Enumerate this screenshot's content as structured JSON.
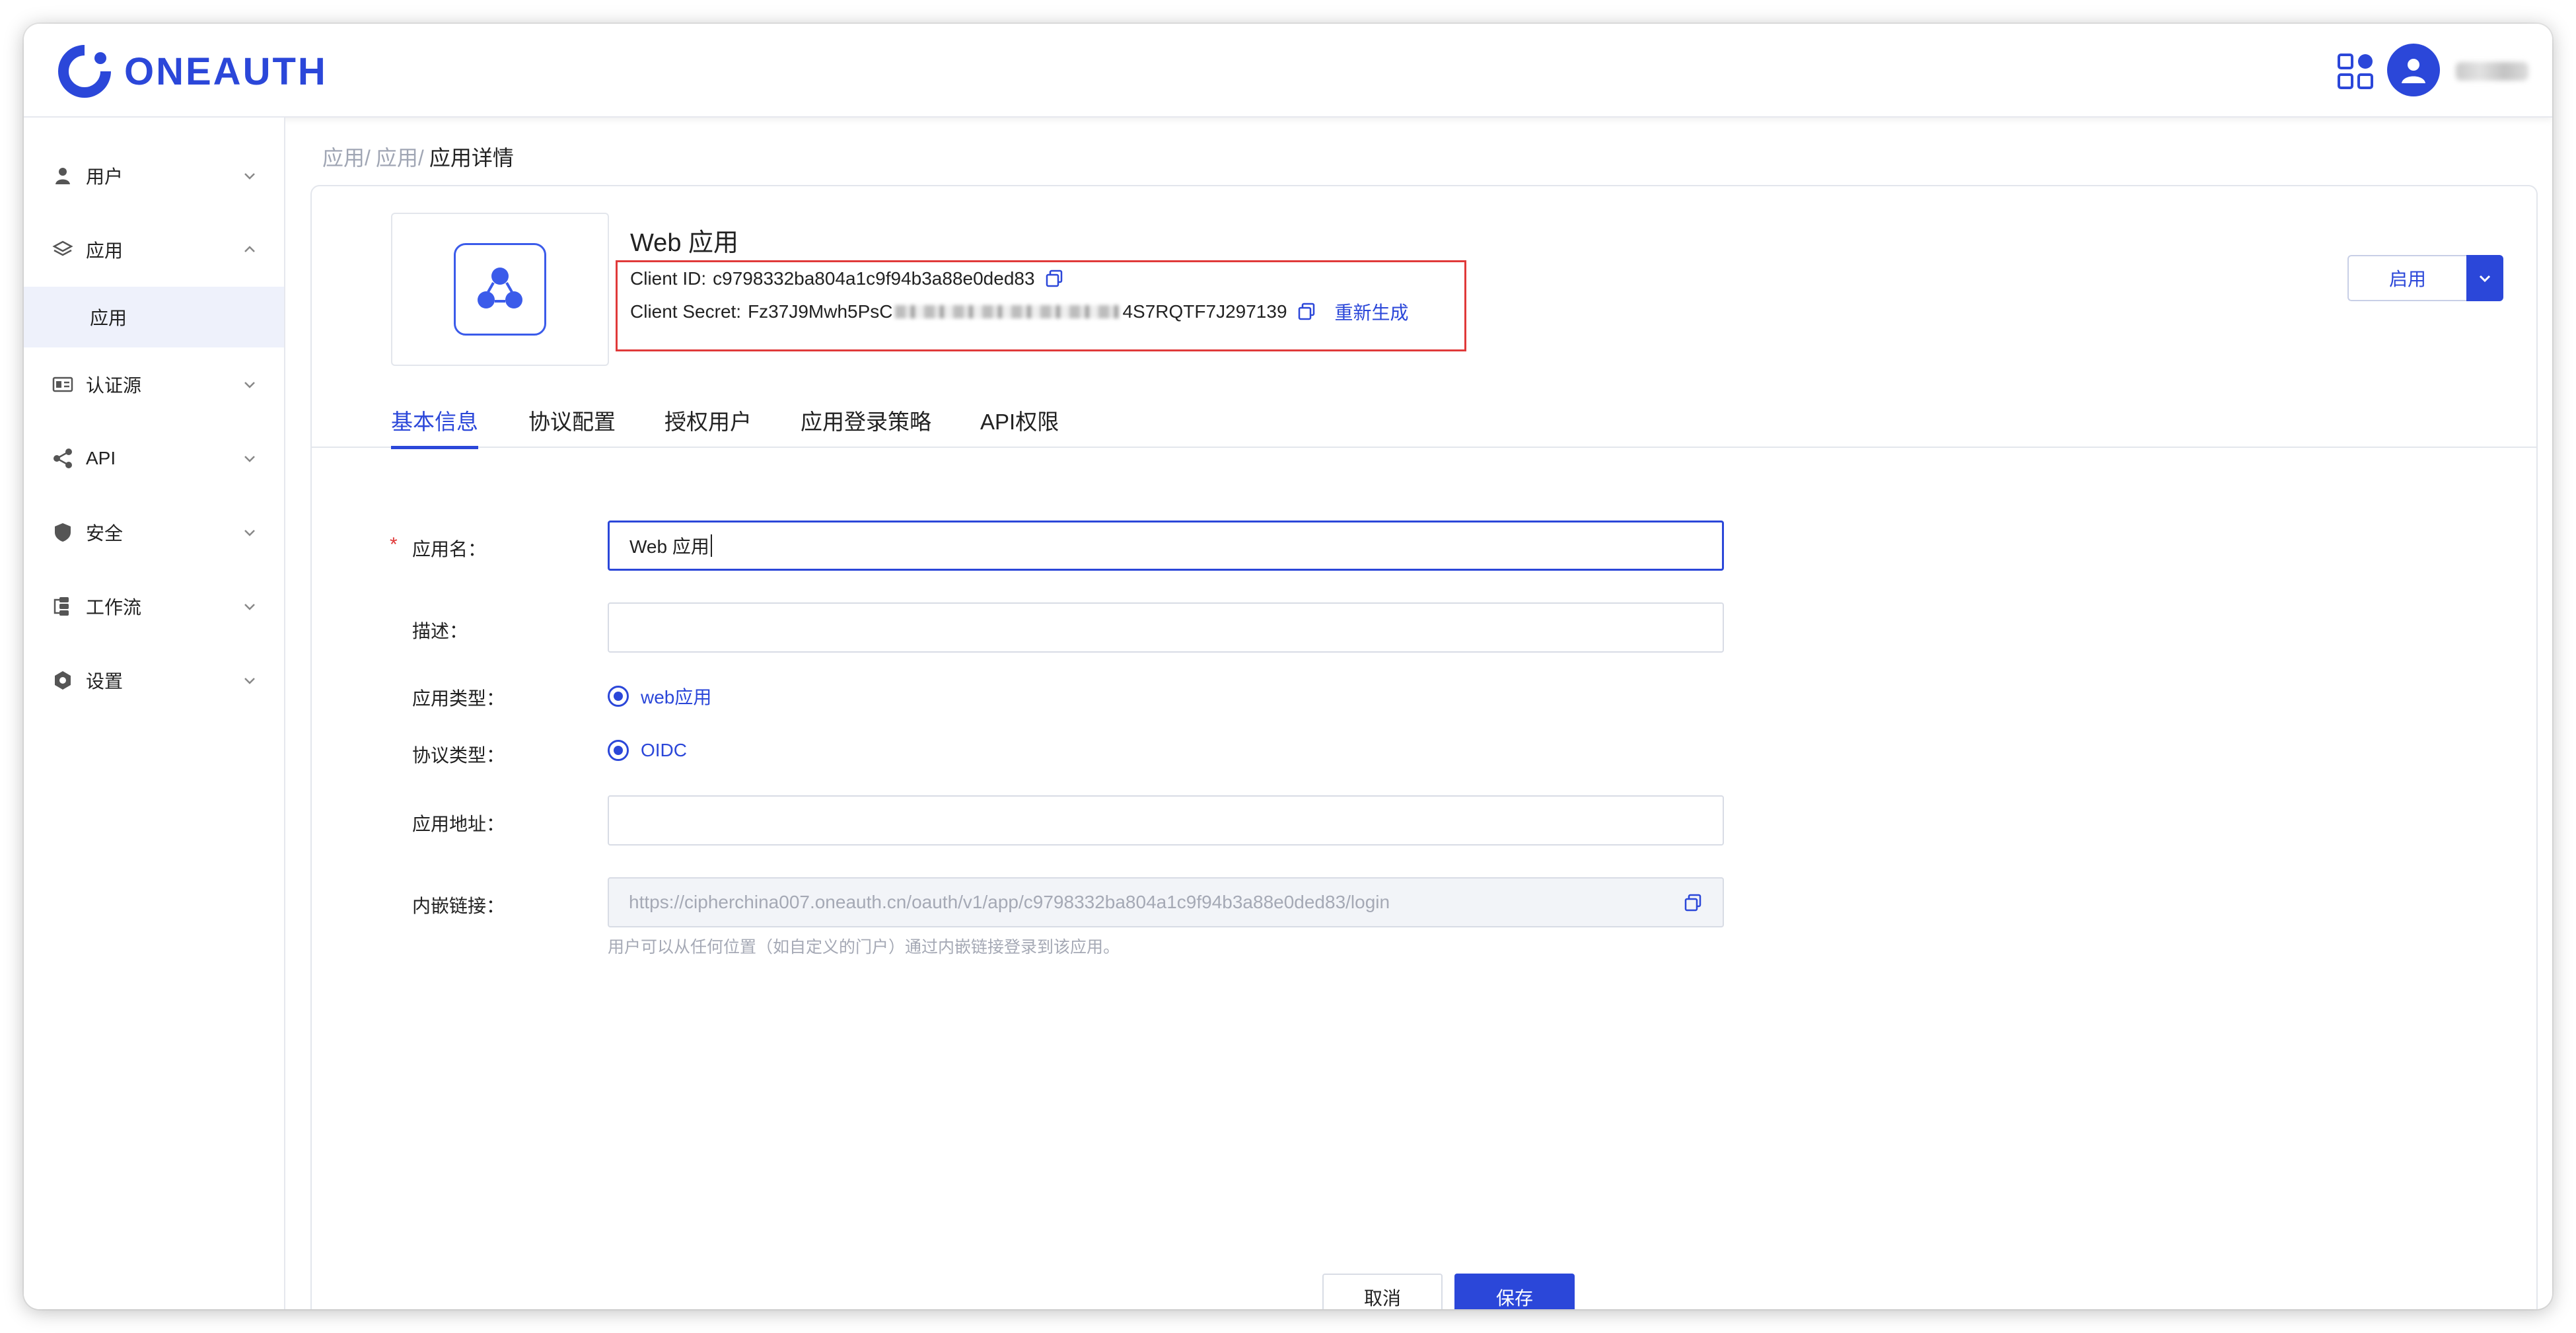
{
  "brand": {
    "name": "ONEAUTH",
    "accent": "#2b47d9"
  },
  "header": {
    "apps_icon": "grid-apps-icon",
    "avatar_icon": "user-avatar-icon"
  },
  "sidebar": {
    "items": [
      {
        "label": "用户",
        "icon": "user-icon"
      },
      {
        "label": "应用",
        "icon": "layers-icon",
        "expanded": true,
        "children": [
          {
            "label": "应用"
          }
        ]
      },
      {
        "label": "认证源",
        "icon": "id-card-icon"
      },
      {
        "label": "API",
        "icon": "share-icon"
      },
      {
        "label": "安全",
        "icon": "shield-icon"
      },
      {
        "label": "工作流",
        "icon": "workflow-icon"
      },
      {
        "label": "设置",
        "icon": "gear-icon"
      }
    ]
  },
  "breadcrumb": [
    "应用/",
    "应用/",
    "应用详情"
  ],
  "app": {
    "title": "Web 应用",
    "client_id_label": "Client ID:",
    "client_id": "c9798332ba804a1c9f94b3a88e0ded83",
    "client_secret_label": "Client Secret:",
    "client_secret_prefix": "Fz37J9Mwh5PsC",
    "client_secret_suffix": "4S7RQTF7J297139",
    "regenerate": "重新生成",
    "status_label": "启用"
  },
  "tabs": [
    "基本信息",
    "协议配置",
    "授权用户",
    "应用登录策略",
    "API权限"
  ],
  "form": {
    "app_name_label": "应用名：",
    "app_name_value": "Web 应用",
    "desc_label": "描述：",
    "desc_value": "",
    "app_type_label": "应用类型：",
    "app_type_value": "web应用",
    "protocol_label": "协议类型：",
    "protocol_value": "OIDC",
    "app_url_label": "应用地址：",
    "app_url_value": "",
    "embed_label": "内嵌链接：",
    "embed_value": "https://cipherchina007.oneauth.cn/oauth/v1/app/c9798332ba804a1c9f94b3a88e0ded83/login",
    "embed_hint": "用户可以从任何位置（如自定义的门户）通过内嵌链接登录到该应用。"
  },
  "actions": {
    "cancel": "取消",
    "save": "保存"
  }
}
